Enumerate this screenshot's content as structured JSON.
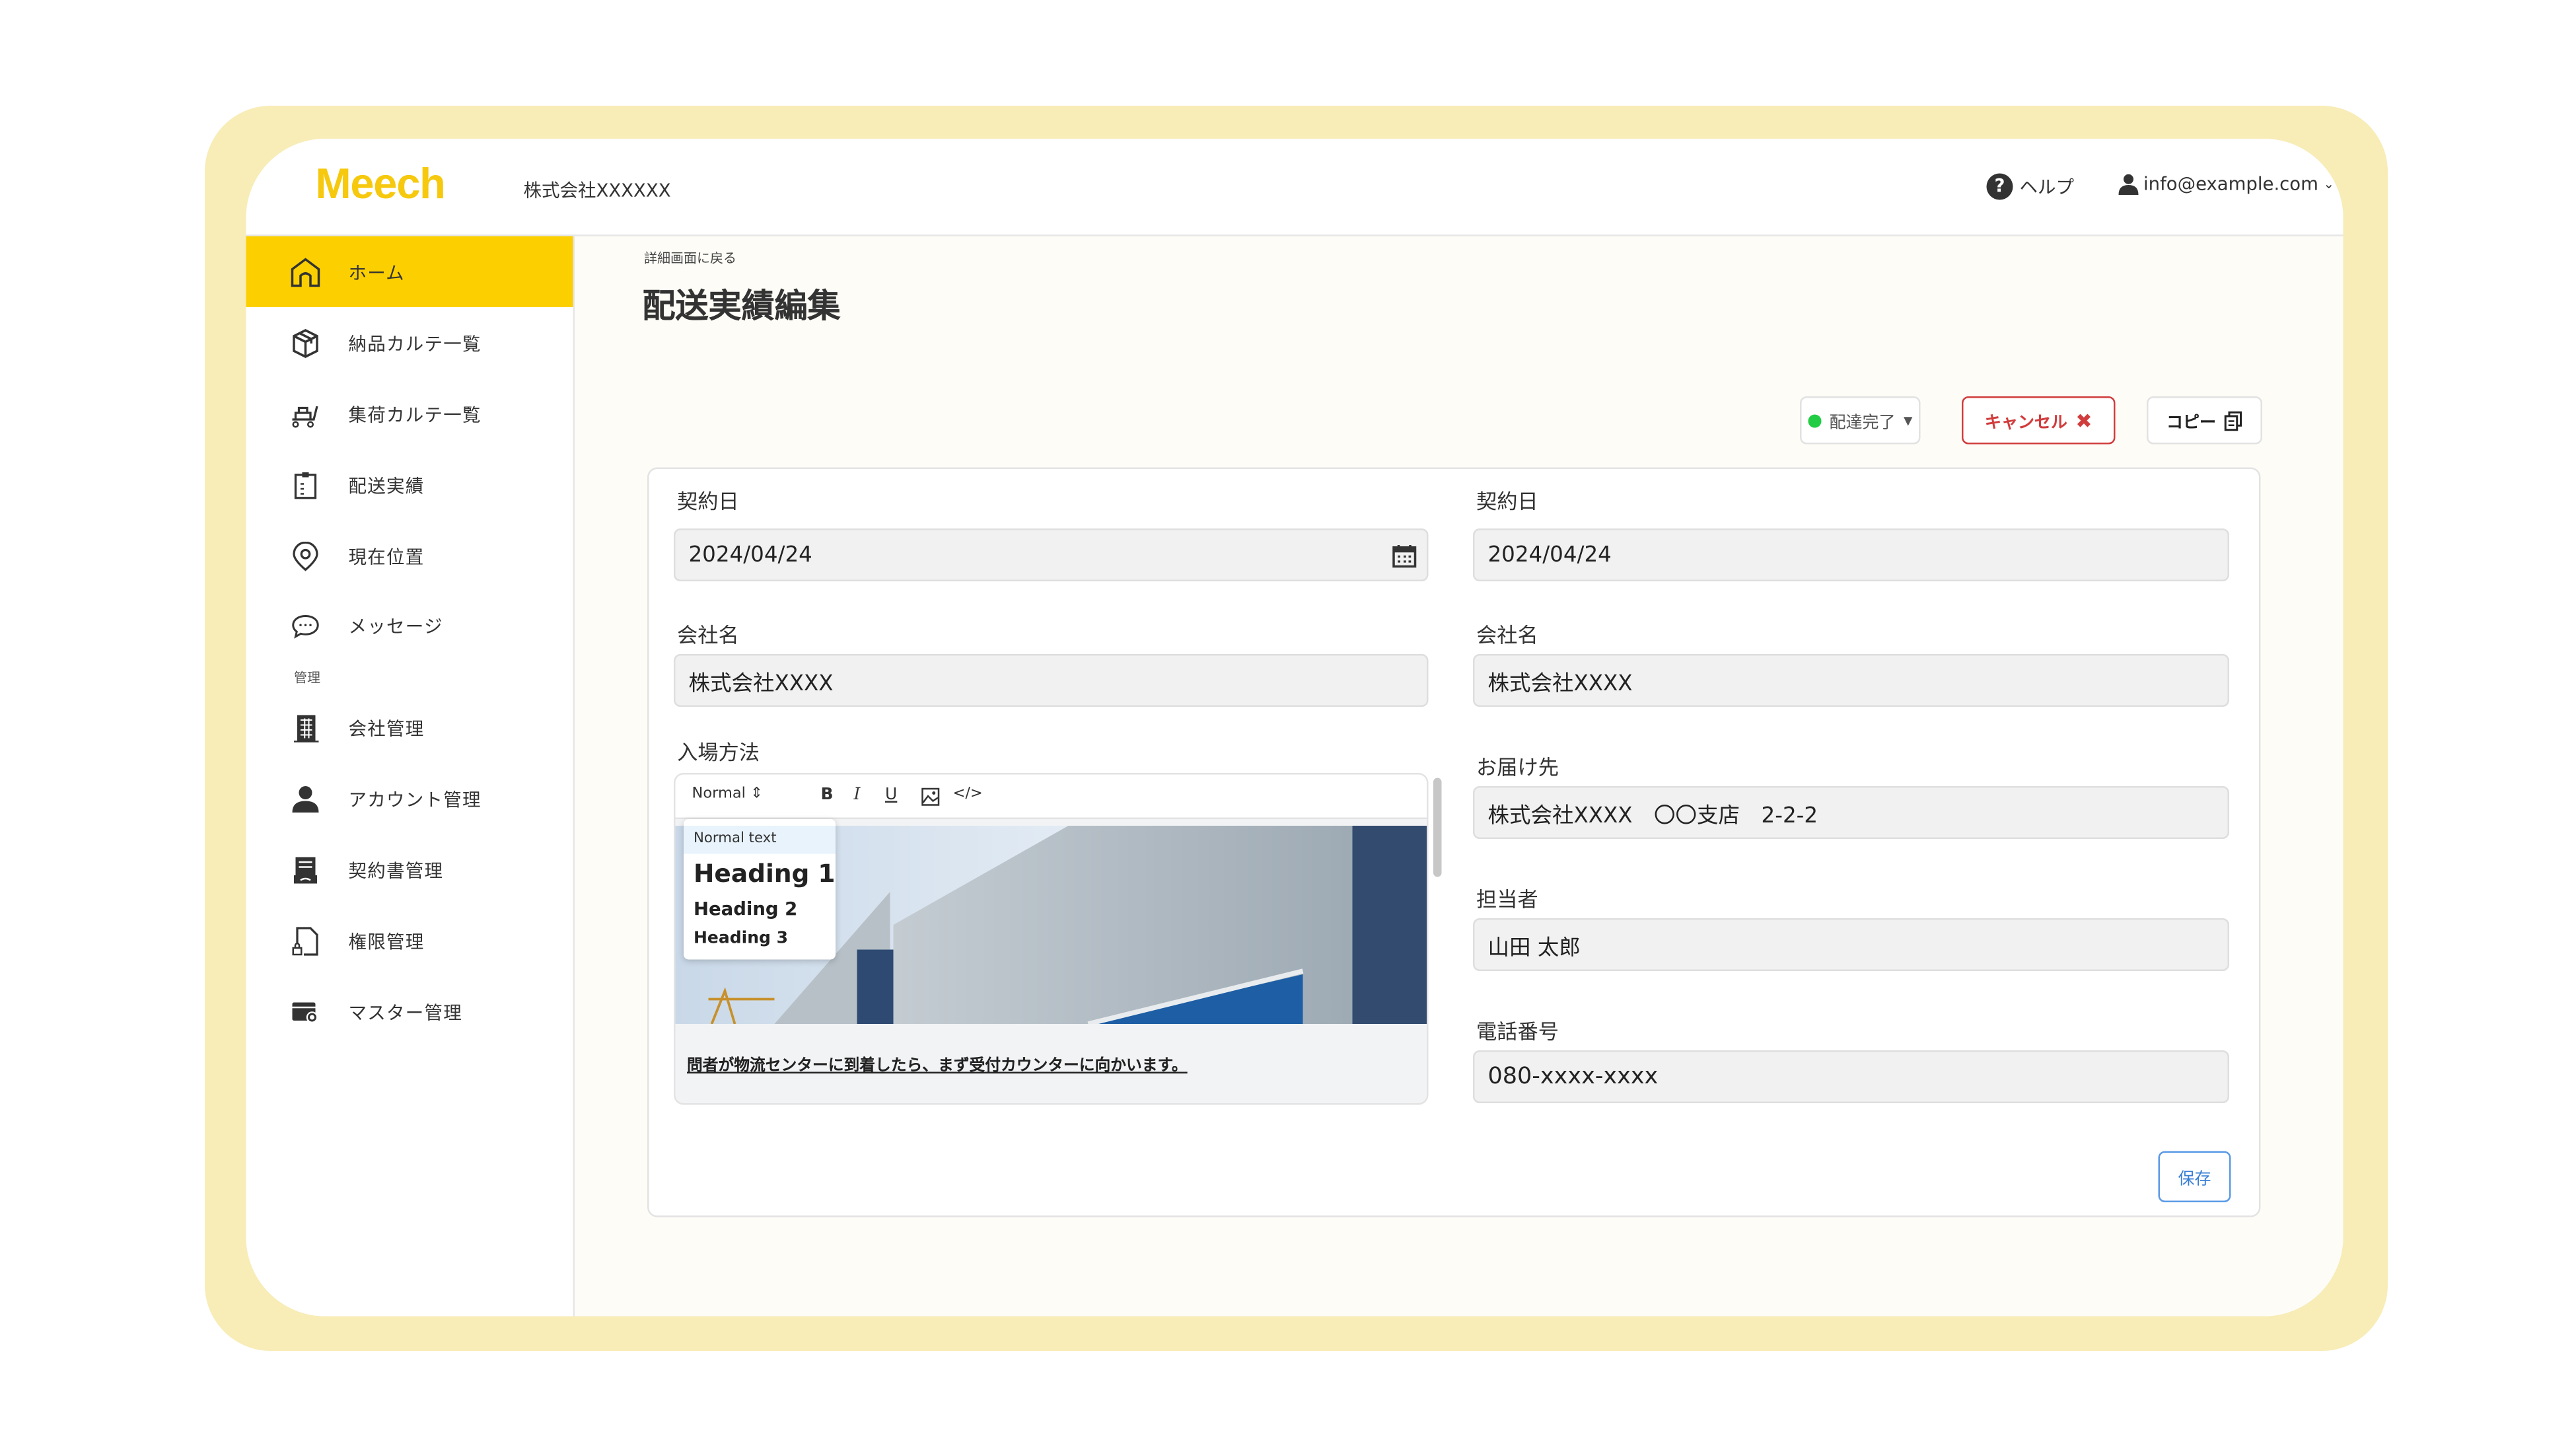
{
  "header": {
    "logo": "Meech",
    "company": "株式会社XXXXXX",
    "help_label": "ヘルプ",
    "user_email": "info@example.com"
  },
  "sidebar": {
    "items": [
      {
        "label": "ホーム",
        "icon": "home-icon",
        "active": true
      },
      {
        "label": "納品カルテ一覧",
        "icon": "package-icon"
      },
      {
        "label": "集荷カルテ一覧",
        "icon": "cart-icon"
      },
      {
        "label": "配送実績",
        "icon": "clipboard-icon"
      },
      {
        "label": "現在位置",
        "icon": "location-pin-icon"
      },
      {
        "label": "メッセージ",
        "icon": "chat-icon"
      }
    ],
    "section_label": "管理",
    "admin_items": [
      {
        "label": "会社管理",
        "icon": "building-icon"
      },
      {
        "label": "アカウント管理",
        "icon": "user-icon"
      },
      {
        "label": "契約書管理",
        "icon": "contract-icon"
      },
      {
        "label": "権限管理",
        "icon": "file-lock-icon"
      },
      {
        "label": "マスター管理",
        "icon": "settings-card-icon"
      }
    ]
  },
  "page": {
    "breadcrumb": "詳細画面に戻る",
    "title": "配送実績編集"
  },
  "actions": {
    "status": "配達完了",
    "status_color": "#22cc44",
    "cancel": "キャンセル",
    "copy": "コピー",
    "save": "保存"
  },
  "form": {
    "left": {
      "contract_date_label": "契約日",
      "contract_date": "2024/04/24",
      "company_label": "会社名",
      "company": "株式会社XXXX",
      "entry_label": "入場方法",
      "editor": {
        "format": "Normal",
        "dropdown": [
          "Normal text",
          "Heading 1",
          "Heading 2",
          "Heading 3"
        ],
        "text": "問者が物流センターに到着したら、まず受付カウンターに向かいます。"
      }
    },
    "right": {
      "contract_date_label": "契約日",
      "contract_date": "2024/04/24",
      "company_label": "会社名",
      "company": "株式会社XXXX",
      "destination_label": "お届け先",
      "destination": "株式会社XXXX　〇〇支店　2-2-2",
      "person_label": "担当者",
      "person": "山田 太郎",
      "phone_label": "電話番号",
      "phone": "080-xxxx-xxxx"
    }
  },
  "colors": {
    "accent": "#fcd000",
    "frame": "#f8ecb7",
    "danger": "#d13c3c",
    "primary": "#3a7fd5"
  }
}
